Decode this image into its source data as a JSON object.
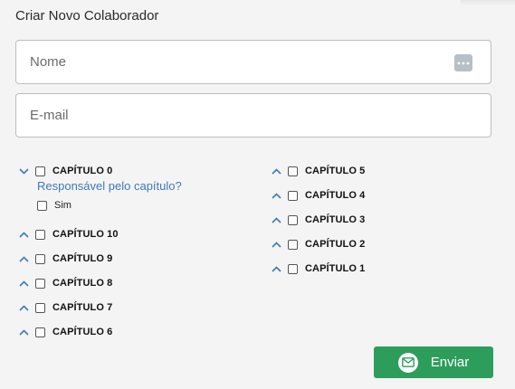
{
  "form": {
    "title": "Criar Novo Colaborador",
    "name_placeholder": "Nome",
    "name_value": "",
    "email_placeholder": "E-mail",
    "email_value": ""
  },
  "chapters_left": [
    {
      "label": "CAPÍTULO 0",
      "expanded": true,
      "checked": false
    },
    {
      "label": "CAPÍTULO 10",
      "expanded": false,
      "checked": false
    },
    {
      "label": "CAPÍTULO 9",
      "expanded": false,
      "checked": false
    },
    {
      "label": "CAPÍTULO 8",
      "expanded": false,
      "checked": false
    },
    {
      "label": "CAPÍTULO 7",
      "expanded": false,
      "checked": false
    },
    {
      "label": "CAPÍTULO 6",
      "expanded": false,
      "checked": false
    }
  ],
  "chapters_right": [
    {
      "label": "CAPÍTULO 5",
      "expanded": false,
      "checked": false
    },
    {
      "label": "CAPÍTULO 4",
      "expanded": false,
      "checked": false
    },
    {
      "label": "CAPÍTULO 3",
      "expanded": false,
      "checked": false
    },
    {
      "label": "CAPÍTULO 2",
      "expanded": false,
      "checked": false
    },
    {
      "label": "CAPÍTULO 1",
      "expanded": false,
      "checked": false
    }
  ],
  "chapter0_details": {
    "responsible_question": "Responsável pelo capítulo?",
    "yes_label": "Sim",
    "yes_checked": false
  },
  "actions": {
    "send_label": "Enviar"
  },
  "colors": {
    "accent_blue": "#3d7ab8",
    "send_green": "#2d9d5c",
    "background": "#f4f4f4"
  },
  "icons": {
    "expand": "chevron-down-icon",
    "collapse": "chevron-up-icon",
    "password_manager": "password-dots-icon",
    "send": "envelope-icon"
  }
}
